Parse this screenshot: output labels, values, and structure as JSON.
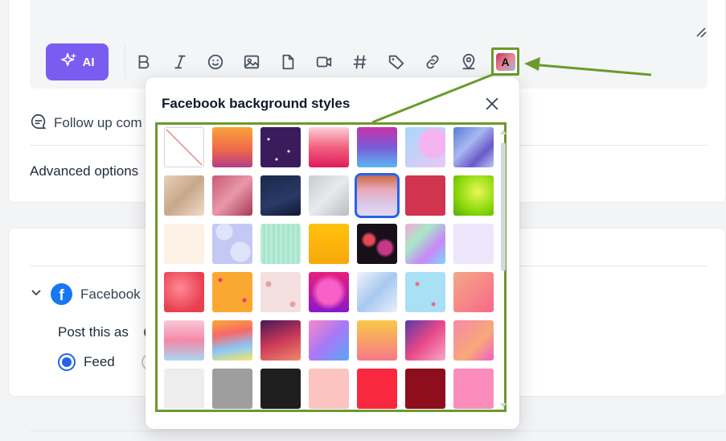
{
  "toolbar": {
    "ai_label": "AI",
    "icons": [
      "bold-icon",
      "italic-icon",
      "emoji-icon",
      "image-icon",
      "file-icon",
      "video-icon",
      "hashtag-icon",
      "tag-icon",
      "link-icon",
      "location-icon"
    ],
    "bg_style_letter": "A"
  },
  "follow_up": {
    "label": "Follow up com"
  },
  "advanced": {
    "label": "Advanced options"
  },
  "facebook_section": {
    "name": "Facebook",
    "post_as_label": "Post this as",
    "feed_label": "Feed"
  },
  "popover": {
    "title": "Facebook background styles",
    "selected_index": 11,
    "swatches": [
      "none",
      "orange-gradient",
      "purple-stars",
      "pink-gradient",
      "purple-blue-gradient",
      "pastel-bubbles",
      "blue-purple-swirl",
      "beige-silk",
      "rose-silk",
      "night-sky",
      "silver-marble",
      "pink-cloud-sunset",
      "crimson-red",
      "lime-glow",
      "cream-peach",
      "lavender-circles",
      "mint-pattern",
      "yellow-orange",
      "dark-bokeh",
      "holographic",
      "light-lavender",
      "red-hearts",
      "orange-confetti",
      "pink-petals",
      "magenta-heart",
      "white-blue-wave",
      "blue-confetti",
      "peach-pink-gradient",
      "pastel-watercolor",
      "rainbow-waves",
      "dark-red-wave",
      "blue-pink-blur",
      "orange-pink-gradient",
      "purple-pink-wave",
      "pink-orange-blur",
      "light-gray",
      "gray",
      "black",
      "light-pink",
      "red",
      "dark-red",
      "pink"
    ]
  },
  "colors": {
    "accent": "#7b5cf0",
    "annotation": "#6a9a2d",
    "selected": "#2563eb",
    "facebook": "#1877f2"
  }
}
